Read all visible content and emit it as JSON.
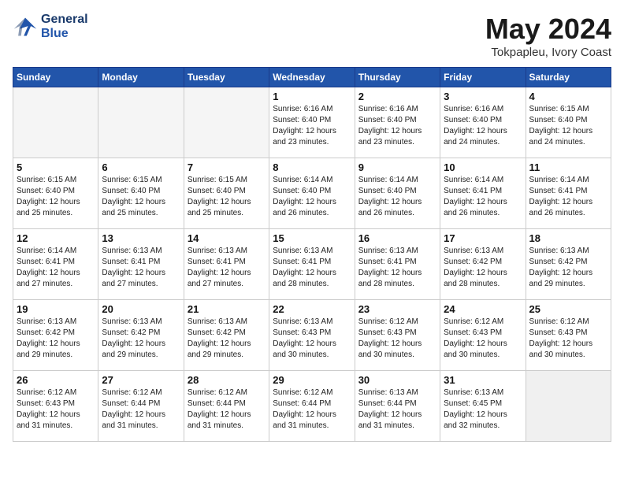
{
  "header": {
    "logo_general": "General",
    "logo_blue": "Blue",
    "month_year": "May 2024",
    "location": "Tokpapleu, Ivory Coast"
  },
  "weekdays": [
    "Sunday",
    "Monday",
    "Tuesday",
    "Wednesday",
    "Thursday",
    "Friday",
    "Saturday"
  ],
  "weeks": [
    [
      {
        "day": "",
        "info": ""
      },
      {
        "day": "",
        "info": ""
      },
      {
        "day": "",
        "info": ""
      },
      {
        "day": "1",
        "info": "Sunrise: 6:16 AM\nSunset: 6:40 PM\nDaylight: 12 hours\nand 23 minutes."
      },
      {
        "day": "2",
        "info": "Sunrise: 6:16 AM\nSunset: 6:40 PM\nDaylight: 12 hours\nand 23 minutes."
      },
      {
        "day": "3",
        "info": "Sunrise: 6:16 AM\nSunset: 6:40 PM\nDaylight: 12 hours\nand 24 minutes."
      },
      {
        "day": "4",
        "info": "Sunrise: 6:15 AM\nSunset: 6:40 PM\nDaylight: 12 hours\nand 24 minutes."
      }
    ],
    [
      {
        "day": "5",
        "info": "Sunrise: 6:15 AM\nSunset: 6:40 PM\nDaylight: 12 hours\nand 25 minutes."
      },
      {
        "day": "6",
        "info": "Sunrise: 6:15 AM\nSunset: 6:40 PM\nDaylight: 12 hours\nand 25 minutes."
      },
      {
        "day": "7",
        "info": "Sunrise: 6:15 AM\nSunset: 6:40 PM\nDaylight: 12 hours\nand 25 minutes."
      },
      {
        "day": "8",
        "info": "Sunrise: 6:14 AM\nSunset: 6:40 PM\nDaylight: 12 hours\nand 26 minutes."
      },
      {
        "day": "9",
        "info": "Sunrise: 6:14 AM\nSunset: 6:40 PM\nDaylight: 12 hours\nand 26 minutes."
      },
      {
        "day": "10",
        "info": "Sunrise: 6:14 AM\nSunset: 6:41 PM\nDaylight: 12 hours\nand 26 minutes."
      },
      {
        "day": "11",
        "info": "Sunrise: 6:14 AM\nSunset: 6:41 PM\nDaylight: 12 hours\nand 26 minutes."
      }
    ],
    [
      {
        "day": "12",
        "info": "Sunrise: 6:14 AM\nSunset: 6:41 PM\nDaylight: 12 hours\nand 27 minutes."
      },
      {
        "day": "13",
        "info": "Sunrise: 6:13 AM\nSunset: 6:41 PM\nDaylight: 12 hours\nand 27 minutes."
      },
      {
        "day": "14",
        "info": "Sunrise: 6:13 AM\nSunset: 6:41 PM\nDaylight: 12 hours\nand 27 minutes."
      },
      {
        "day": "15",
        "info": "Sunrise: 6:13 AM\nSunset: 6:41 PM\nDaylight: 12 hours\nand 28 minutes."
      },
      {
        "day": "16",
        "info": "Sunrise: 6:13 AM\nSunset: 6:41 PM\nDaylight: 12 hours\nand 28 minutes."
      },
      {
        "day": "17",
        "info": "Sunrise: 6:13 AM\nSunset: 6:42 PM\nDaylight: 12 hours\nand 28 minutes."
      },
      {
        "day": "18",
        "info": "Sunrise: 6:13 AM\nSunset: 6:42 PM\nDaylight: 12 hours\nand 29 minutes."
      }
    ],
    [
      {
        "day": "19",
        "info": "Sunrise: 6:13 AM\nSunset: 6:42 PM\nDaylight: 12 hours\nand 29 minutes."
      },
      {
        "day": "20",
        "info": "Sunrise: 6:13 AM\nSunset: 6:42 PM\nDaylight: 12 hours\nand 29 minutes."
      },
      {
        "day": "21",
        "info": "Sunrise: 6:13 AM\nSunset: 6:42 PM\nDaylight: 12 hours\nand 29 minutes."
      },
      {
        "day": "22",
        "info": "Sunrise: 6:13 AM\nSunset: 6:43 PM\nDaylight: 12 hours\nand 30 minutes."
      },
      {
        "day": "23",
        "info": "Sunrise: 6:12 AM\nSunset: 6:43 PM\nDaylight: 12 hours\nand 30 minutes."
      },
      {
        "day": "24",
        "info": "Sunrise: 6:12 AM\nSunset: 6:43 PM\nDaylight: 12 hours\nand 30 minutes."
      },
      {
        "day": "25",
        "info": "Sunrise: 6:12 AM\nSunset: 6:43 PM\nDaylight: 12 hours\nand 30 minutes."
      }
    ],
    [
      {
        "day": "26",
        "info": "Sunrise: 6:12 AM\nSunset: 6:43 PM\nDaylight: 12 hours\nand 31 minutes."
      },
      {
        "day": "27",
        "info": "Sunrise: 6:12 AM\nSunset: 6:44 PM\nDaylight: 12 hours\nand 31 minutes."
      },
      {
        "day": "28",
        "info": "Sunrise: 6:12 AM\nSunset: 6:44 PM\nDaylight: 12 hours\nand 31 minutes."
      },
      {
        "day": "29",
        "info": "Sunrise: 6:12 AM\nSunset: 6:44 PM\nDaylight: 12 hours\nand 31 minutes."
      },
      {
        "day": "30",
        "info": "Sunrise: 6:13 AM\nSunset: 6:44 PM\nDaylight: 12 hours\nand 31 minutes."
      },
      {
        "day": "31",
        "info": "Sunrise: 6:13 AM\nSunset: 6:45 PM\nDaylight: 12 hours\nand 32 minutes."
      },
      {
        "day": "",
        "info": ""
      }
    ]
  ]
}
